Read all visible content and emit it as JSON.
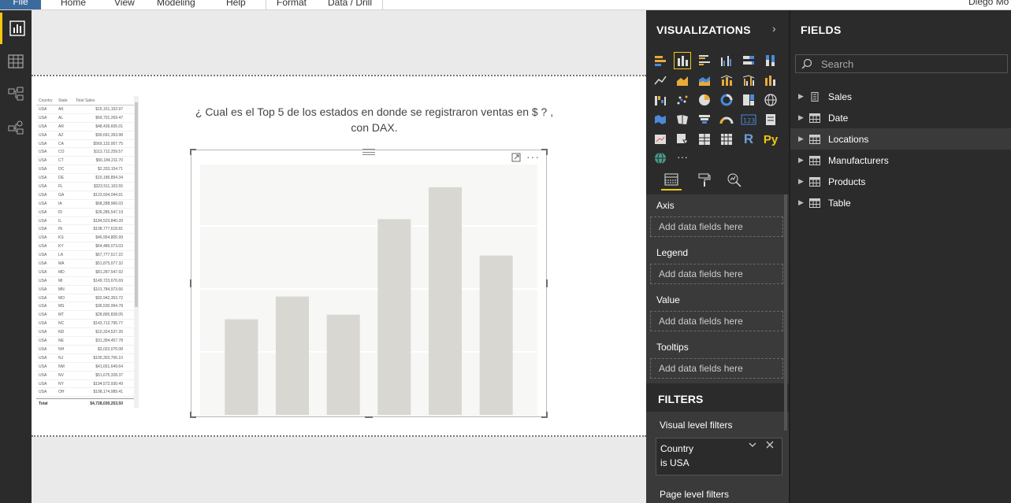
{
  "ribbon": {
    "file_tab": "File",
    "menu": [
      "Home",
      "View",
      "Modeling",
      "Help",
      "Format",
      "Data / Drill"
    ],
    "user_name": "Diego Mo"
  },
  "report": {
    "title_line1": "¿ Cual es el Top 5 de los estados en donde se registraron ventas en $ ? ,",
    "title_line2": "con DAX."
  },
  "table_visual": {
    "columns": [
      "Country",
      "State",
      "Total Sales"
    ],
    "rows": [
      [
        "USA",
        "AK",
        "$15,151,152.97"
      ],
      [
        "USA",
        "AL",
        "$69,701,269.47"
      ],
      [
        "USA",
        "AR",
        "$48,439,605.01"
      ],
      [
        "USA",
        "AZ",
        "$99,691,353.98"
      ],
      [
        "USA",
        "CA",
        "$569,132,007.75"
      ],
      [
        "USA",
        "CO",
        "$113,712,259.57"
      ],
      [
        "USA",
        "CT",
        "$56,184,211.70"
      ],
      [
        "USA",
        "DC",
        "$2,333,154.71"
      ],
      [
        "USA",
        "DE",
        "$15,186,894.34"
      ],
      [
        "USA",
        "FL",
        "$323,511,103.55"
      ],
      [
        "USA",
        "GA",
        "$123,934,044.91"
      ],
      [
        "USA",
        "IA",
        "$68,288,966.03"
      ],
      [
        "USA",
        "ID",
        "$39,285,547.19"
      ],
      [
        "USA",
        "IL",
        "$184,523,840.39"
      ],
      [
        "USA",
        "IN",
        "$108,777,618.81"
      ],
      [
        "USA",
        "KS",
        "$46,954,805.99"
      ],
      [
        "USA",
        "KY",
        "$64,486,073.03"
      ],
      [
        "USA",
        "LA",
        "$67,777,517.22"
      ],
      [
        "USA",
        "MA",
        "$51,875,077.32"
      ],
      [
        "USA",
        "MD",
        "$81,287,547.92"
      ],
      [
        "USA",
        "MI",
        "$149,723,676.69"
      ],
      [
        "USA",
        "MN",
        "$101,784,973.66"
      ],
      [
        "USA",
        "MO",
        "$92,942,353.72"
      ],
      [
        "USA",
        "MS",
        "$36,530,994.78"
      ],
      [
        "USA",
        "MT",
        "$28,895,828.05"
      ],
      [
        "USA",
        "NC",
        "$143,712,795.77"
      ],
      [
        "USA",
        "ND",
        "$10,324,537.26"
      ],
      [
        "USA",
        "NE",
        "$31,394,457.78"
      ],
      [
        "USA",
        "NH",
        "$3,022,076.08"
      ],
      [
        "USA",
        "NJ",
        "$105,302,706.10"
      ],
      [
        "USA",
        "NM",
        "$41,651,649.64"
      ],
      [
        "USA",
        "NV",
        "$51,675,328.37"
      ],
      [
        "USA",
        "NY",
        "$194,572,930.49"
      ],
      [
        "USA",
        "OH",
        "$198,174,989.41"
      ]
    ],
    "total_label": "Total",
    "total_value": "$4,728,030,253.50"
  },
  "chart_data": {
    "type": "bar",
    "bar_color": "#d9d7d2",
    "values": [
      42,
      52,
      44,
      86,
      100,
      70
    ],
    "ylim": [
      0,
      110
    ]
  },
  "visualizations": {
    "title": "VISUALIZATIONS",
    "wells": [
      {
        "label": "Axis",
        "placeholder": "Add data fields here"
      },
      {
        "label": "Legend",
        "placeholder": "Add data fields here"
      },
      {
        "label": "Value",
        "placeholder": "Add data fields here"
      },
      {
        "label": "Tooltips",
        "placeholder": "Add data fields here"
      }
    ],
    "r_label": "R",
    "py_label": "Py",
    "num_label": "123",
    "more_label": "···"
  },
  "filters": {
    "title": "FILTERS",
    "visual_level": "Visual level filters",
    "card_field": "Country",
    "card_condition": "is USA",
    "page_level": "Page level filters"
  },
  "fields": {
    "title": "FIELDS",
    "search_placeholder": "Search",
    "tables": [
      "Sales",
      "Date",
      "Locations",
      "Manufacturers",
      "Products",
      "Table"
    ]
  },
  "colors": {
    "accent": "#f2c811",
    "pane_bg": "#2b2b2b",
    "file_tab": "#3b6a9c"
  }
}
